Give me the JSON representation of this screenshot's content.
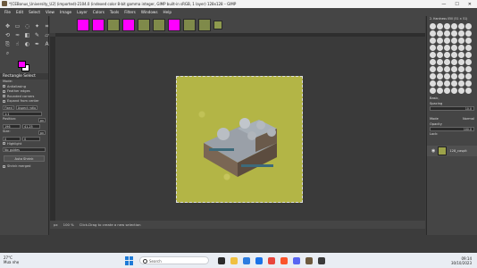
{
  "window": {
    "title": "*[CEBonus_University_U2] (imported)-2104.0 (indexed color 8-bit gamma integer, GIMP built-in sRGB, 1 layer) 128x128 – GIMP",
    "controls": [
      "—",
      "☐",
      "✕"
    ]
  },
  "menu": [
    "File",
    "Edit",
    "Select",
    "View",
    "Image",
    "Layer",
    "Colors",
    "Tools",
    "Filters",
    "Windows",
    "Help"
  ],
  "tool_options": {
    "title": "Rectangle Select",
    "mode_label": "Mode:",
    "options": [
      "Antialiasing",
      "Feather edges",
      "Rounded corners",
      "Expand from center"
    ],
    "fixed_label": "Fixed",
    "fixed_value": "Aspect ratio",
    "ratio_value": "1:1",
    "position_label": "Position:",
    "position_unit": "px",
    "pos_x": "196",
    "pos_y": "41.25",
    "size_label": "Size:",
    "size_unit": "px",
    "size_x": "0",
    "size_y": "0",
    "highlight_label": "Highlight",
    "guides_value": "No guides",
    "auto_shrink": "Auto Shrink",
    "shrink_merged": "Shrink merged"
  },
  "statusbar": {
    "units": "px",
    "zoom": "100 %",
    "message": "Click-Drag to create a new selection"
  },
  "right_panel": {
    "brush_name": "2. Hardness 050 (51 × 51)",
    "brush_category": "Basic,",
    "spacing_label": "Spacing",
    "spacing_value": "10.0",
    "mode_label": "Mode",
    "mode_value": "Normal",
    "opacity_label": "Opacity",
    "opacity_value": "100.0",
    "lock_label": "Lock:",
    "layer_name": "128_caspit"
  },
  "taskbar": {
    "temp": "27°C",
    "weather": "Mưa nhẹ",
    "search_placeholder": "Search",
    "time": "09:14",
    "date": "30/10/2023"
  }
}
